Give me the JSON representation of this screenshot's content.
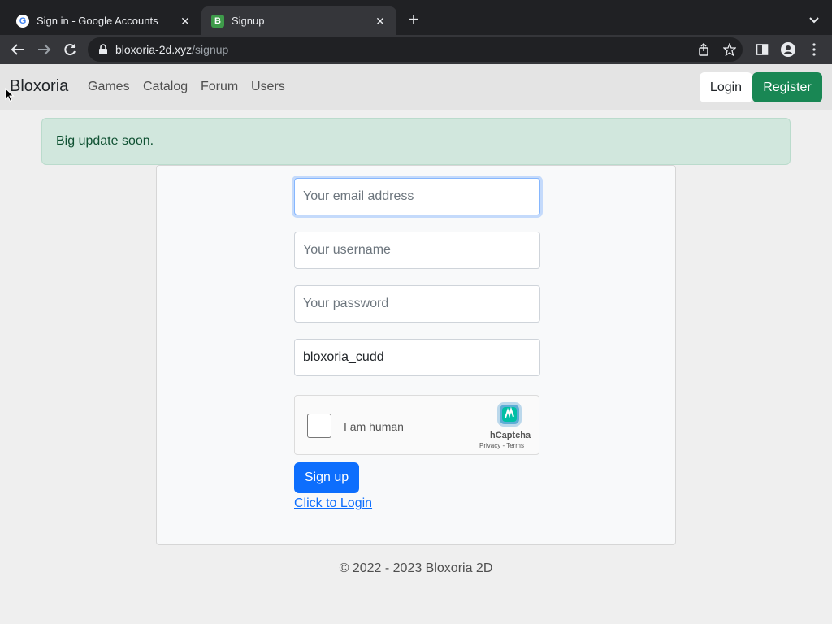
{
  "browser": {
    "tabs": [
      {
        "title": "Sign in - Google Accounts",
        "favicon": "G"
      },
      {
        "title": "Signup",
        "favicon": "B"
      }
    ],
    "new_tab_label": "+",
    "close_glyph": "✕",
    "url": {
      "host": "bloxoria-2d.xyz",
      "path": "/signup"
    }
  },
  "navbar": {
    "brand": "Bloxoria",
    "links": [
      "Games",
      "Catalog",
      "Forum",
      "Users"
    ],
    "login": "Login",
    "register": "Register"
  },
  "alert": {
    "text": "Big update soon."
  },
  "form": {
    "email": {
      "placeholder": "Your email address",
      "value": ""
    },
    "username": {
      "placeholder": "Your username",
      "value": ""
    },
    "password": {
      "placeholder": "Your password",
      "value": ""
    },
    "extra": {
      "value": "bloxoria_cudd"
    },
    "captcha": {
      "label": "I am human",
      "brand": "hCaptcha",
      "links": "Privacy - Terms"
    },
    "submit": "Sign up",
    "login_link": "Click to Login"
  },
  "footer": {
    "text": "© 2022 - 2023 Bloxoria 2D"
  },
  "colors": {
    "accent": "#0d6efd",
    "register": "#198754",
    "alert_bg": "#d1e7dd",
    "alert_text": "#0f5132"
  }
}
